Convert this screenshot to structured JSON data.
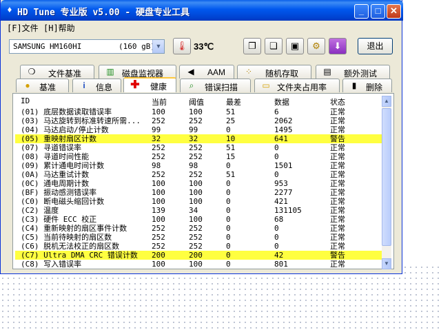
{
  "window": {
    "title": "HD Tune 专业版 v5.00 - 硬盘专业工具"
  },
  "menu": {
    "file": "[F]文件",
    "help": "[H]帮助"
  },
  "toolbar": {
    "drive_name": "SAMSUNG HM160HI",
    "drive_size": "(160 gB)",
    "temperature": "33℃",
    "exit_label": "退出"
  },
  "tabs_top": [
    {
      "label": "文件基准",
      "icon": "file-benchmark-icon"
    },
    {
      "label": "磁盘监视器",
      "icon": "disk-monitor-icon"
    },
    {
      "label": "AAM",
      "icon": "speaker-icon"
    },
    {
      "label": "随机存取",
      "icon": "random-access-icon"
    },
    {
      "label": "额外测试",
      "icon": "extra-tests-icon"
    }
  ],
  "tabs_bottom": [
    {
      "label": "基准",
      "icon": "benchmark-icon"
    },
    {
      "label": "信息",
      "icon": "info-icon"
    },
    {
      "label": "健康",
      "icon": "health-icon"
    },
    {
      "label": "错误扫描",
      "icon": "error-scan-icon"
    },
    {
      "label": "文件夹占用率",
      "icon": "folder-icon"
    },
    {
      "label": "删除",
      "icon": "trash-icon"
    }
  ],
  "columns": [
    "ID",
    "当前",
    "阈值",
    "最差",
    "数据",
    "状态"
  ],
  "rows": [
    {
      "id": "(01) 底层数据读取错误率",
      "cur": "100",
      "thr": "100",
      "worst": "51",
      "data": "6",
      "status": "正常",
      "warn": false
    },
    {
      "id": "(03) 马达旋转到标准转速所需...",
      "cur": "252",
      "thr": "252",
      "worst": "25",
      "data": "2062",
      "status": "正常",
      "warn": false
    },
    {
      "id": "(04) 马达启动/停止计数",
      "cur": "99",
      "thr": "99",
      "worst": "0",
      "data": "1495",
      "status": "正常",
      "warn": false
    },
    {
      "id": "(05) 重映射扇区计数",
      "cur": "32",
      "thr": "32",
      "worst": "10",
      "data": "641",
      "status": "警告",
      "warn": true
    },
    {
      "id": "(07) 寻道错误率",
      "cur": "252",
      "thr": "252",
      "worst": "51",
      "data": "0",
      "status": "正常",
      "warn": false
    },
    {
      "id": "(08) 寻道时间性能",
      "cur": "252",
      "thr": "252",
      "worst": "15",
      "data": "0",
      "status": "正常",
      "warn": false
    },
    {
      "id": "(09) 累计通电时间计数",
      "cur": "98",
      "thr": "98",
      "worst": "0",
      "data": "1501",
      "status": "正常",
      "warn": false
    },
    {
      "id": "(0A) 马达重试计数",
      "cur": "252",
      "thr": "252",
      "worst": "51",
      "data": "0",
      "status": "正常",
      "warn": false
    },
    {
      "id": "(0C) 通电周期计数",
      "cur": "100",
      "thr": "100",
      "worst": "0",
      "data": "953",
      "status": "正常",
      "warn": false
    },
    {
      "id": "(BF) 振动感测错误率",
      "cur": "100",
      "thr": "100",
      "worst": "0",
      "data": "2277",
      "status": "正常",
      "warn": false
    },
    {
      "id": "(C0) 断电磁头缩回计数",
      "cur": "100",
      "thr": "100",
      "worst": "0",
      "data": "421",
      "status": "正常",
      "warn": false
    },
    {
      "id": "(C2) 温度",
      "cur": "139",
      "thr": "34",
      "worst": "0",
      "data": "131105",
      "status": "正常",
      "warn": false
    },
    {
      "id": "(C3) 硬件 ECC 校正",
      "cur": "100",
      "thr": "100",
      "worst": "0",
      "data": "68",
      "status": "正常",
      "warn": false
    },
    {
      "id": "(C4) 重新映射的扇区事件计数",
      "cur": "252",
      "thr": "252",
      "worst": "0",
      "data": "0",
      "status": "正常",
      "warn": false
    },
    {
      "id": "(C5) 当前待映射的扇区数",
      "cur": "252",
      "thr": "252",
      "worst": "0",
      "data": "0",
      "status": "正常",
      "warn": false
    },
    {
      "id": "(C6) 脱机无法校正的扇区数",
      "cur": "252",
      "thr": "252",
      "worst": "0",
      "data": "0",
      "status": "正常",
      "warn": false
    },
    {
      "id": "(C7) Ultra DMA CRC 错误计数",
      "cur": "200",
      "thr": "200",
      "worst": "0",
      "data": "42",
      "status": "警告",
      "warn": true
    },
    {
      "id": "(C8) 写入错误率",
      "cur": "100",
      "thr": "100",
      "worst": "0",
      "data": "801",
      "status": "正常",
      "warn": false
    }
  ]
}
